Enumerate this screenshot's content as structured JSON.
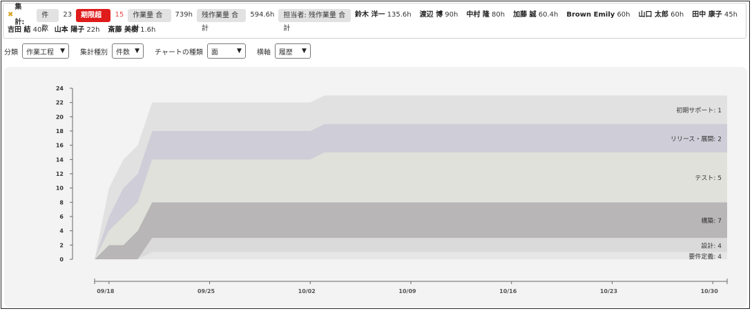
{
  "summary": {
    "title": "集計:",
    "count_label": "件数",
    "count_value": "23",
    "overdue_label": "期限超過",
    "overdue_value": "15",
    "work_total_label": "作業量 合計",
    "work_total_value": "739h",
    "remaining_total_label": "残作業量 合計",
    "remaining_total_value": "594.6h",
    "assignee_label": "担当者: 残作業量 合計",
    "people_row1": [
      {
        "name": "鈴木 洋一",
        "hours": "135.6h"
      },
      {
        "name": "渡辺 博",
        "hours": "90h"
      },
      {
        "name": "中村 隆",
        "hours": "80h"
      },
      {
        "name": "加藤 誠",
        "hours": "60.4h"
      },
      {
        "name": "Brown Emily",
        "hours": "60h"
      },
      {
        "name": "山口 太郎",
        "hours": "60h"
      },
      {
        "name": "田中 康子",
        "hours": "45h"
      }
    ],
    "people_row2": [
      {
        "name": "吉田 結",
        "hours": "40h"
      },
      {
        "name": "山本 陽子",
        "hours": "22h"
      },
      {
        "name": "斎藤 美樹",
        "hours": "1.6h"
      }
    ]
  },
  "controls": {
    "category_label": "分類",
    "category_value": "作業工程",
    "agg_label": "集計種別",
    "agg_value": "件数",
    "chart_type_label": "チャートの種類",
    "chart_type_value": "面",
    "x_axis_label": "横軸",
    "x_axis_value": "履歴"
  },
  "chart_data": {
    "type": "area",
    "stacked": true,
    "ylim": [
      0,
      24
    ],
    "yticks": [
      0,
      2,
      4,
      6,
      8,
      10,
      12,
      14,
      16,
      18,
      20,
      22,
      24
    ],
    "xtick_labels": [
      "09/18",
      "09/25",
      "10/02",
      "10/09",
      "10/16",
      "10/23",
      "10/30"
    ],
    "x": [
      "09/17",
      "09/18",
      "09/19",
      "09/20",
      "09/21",
      "09/28",
      "10/02",
      "10/03",
      "10/31"
    ],
    "series": [
      {
        "name": "初期サポート",
        "values": [
          0,
          0,
          0,
          0,
          1,
          1,
          1,
          1,
          1
        ],
        "color": "#e6e6e6"
      },
      {
        "name": "リリース・展開",
        "values": [
          0,
          0,
          0,
          0,
          2,
          2,
          2,
          2,
          2
        ],
        "color": "#dadada"
      },
      {
        "name": "テスト",
        "values": [
          0,
          2,
          2,
          4,
          5,
          5,
          5,
          5,
          5
        ],
        "color": "#b8b6b6"
      },
      {
        "name": "構築",
        "values": [
          0,
          2,
          4,
          4,
          6,
          6,
          6,
          7,
          7
        ],
        "color": "#dfe1da"
      },
      {
        "name": "設計",
        "values": [
          0,
          2,
          4,
          4,
          4,
          4,
          4,
          4,
          4
        ],
        "color": "#cfcdd7"
      },
      {
        "name": "要件定義",
        "values": [
          0,
          4,
          4,
          4,
          4,
          4,
          4,
          4,
          4
        ],
        "color": "#e1e1e1"
      }
    ],
    "labels": [
      "要件定義: 4",
      "設計: 4",
      "構築: 7",
      "テスト: 5",
      "リリース・展開: 2",
      "初期サポート: 1"
    ]
  }
}
